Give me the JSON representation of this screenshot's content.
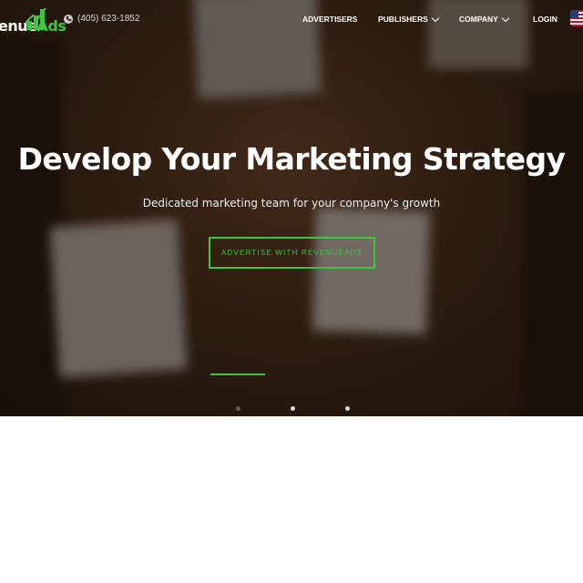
{
  "header": {
    "logo_prefix": "enue",
    "logo_suffix": "Ads",
    "phone": "(405) 623-1852",
    "nav": [
      {
        "label": "ADVERTISERS",
        "dropdown": false
      },
      {
        "label": "PUBLISHERS",
        "dropdown": true
      },
      {
        "label": "COMPANY",
        "dropdown": true
      },
      {
        "label": "LOGIN",
        "dropdown": false
      }
    ],
    "language_flag": "us-flag-icon"
  },
  "hero": {
    "title": "Develop Your Marketing Strategy",
    "subtitle": "Dedicated marketing team for your company's growth",
    "cta_label": "ADVERTISE WITH REVENUEADS",
    "slides_count": 3,
    "active_slide": 1
  },
  "colors": {
    "accent": "#3ec541",
    "text": "#ffffff",
    "page_background": "#ffffff"
  }
}
